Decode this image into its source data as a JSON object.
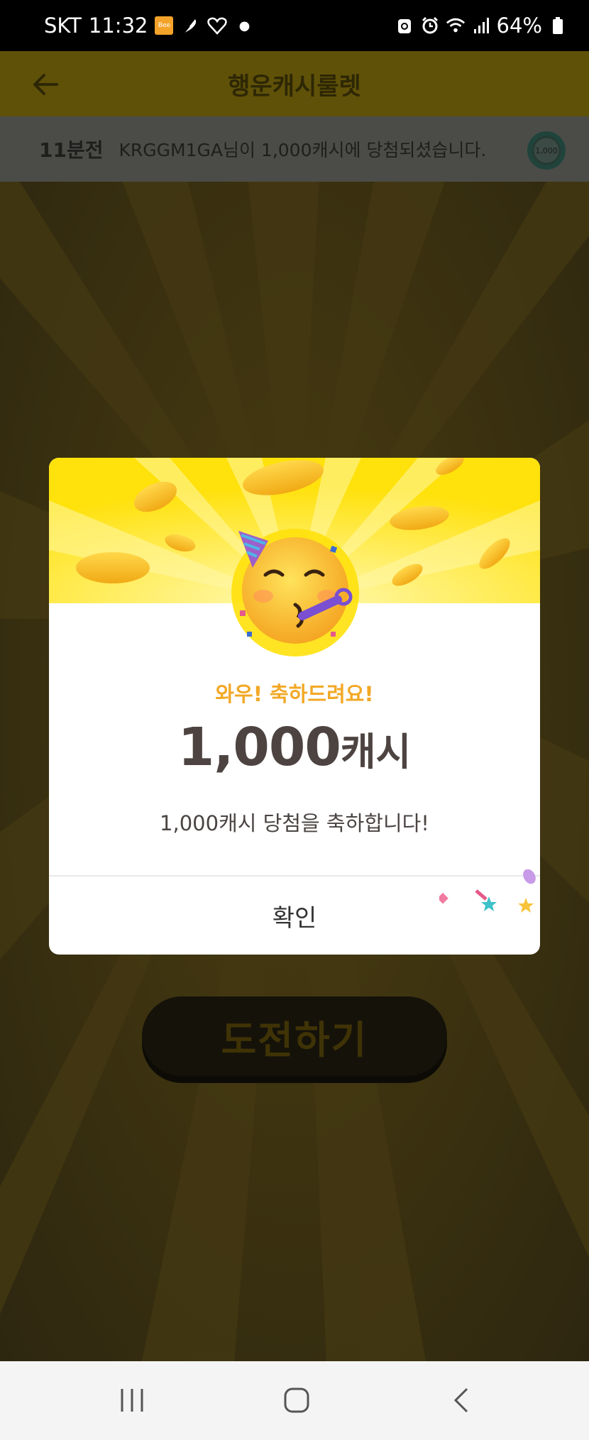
{
  "status_bar": {
    "carrier": "SKT",
    "time": "11:32",
    "bee_badge": "Bee",
    "battery": "64%",
    "icons": [
      "bee-app-icon",
      "feather-icon",
      "heart-icon",
      "dot-icon",
      "recycle-icon",
      "alarm-icon",
      "wifi-icon",
      "signal-icon",
      "battery-icon"
    ]
  },
  "header": {
    "title": "행운캐시룰렛",
    "back_icon": "arrow-left-icon"
  },
  "ticker": {
    "time_ago": "11분전",
    "message": "KRGGM1GA님이 1,000캐시에 당첨되셨습니다.",
    "chip_label": "1,000"
  },
  "challenge_button": {
    "label": "도전하기"
  },
  "modal": {
    "wow": "와우! 축하드려요!",
    "amount": "1,000",
    "unit": "캐시",
    "message": "1,000캐시 당첨을 축하합니다!",
    "confirm": "확인"
  },
  "nav_bar": {
    "items": [
      "recent-apps-icon",
      "home-icon",
      "back-icon"
    ]
  },
  "colors": {
    "accent_yellow": "#ffe10b",
    "wow_orange": "#f2a825",
    "amount_text": "#4d4441"
  }
}
